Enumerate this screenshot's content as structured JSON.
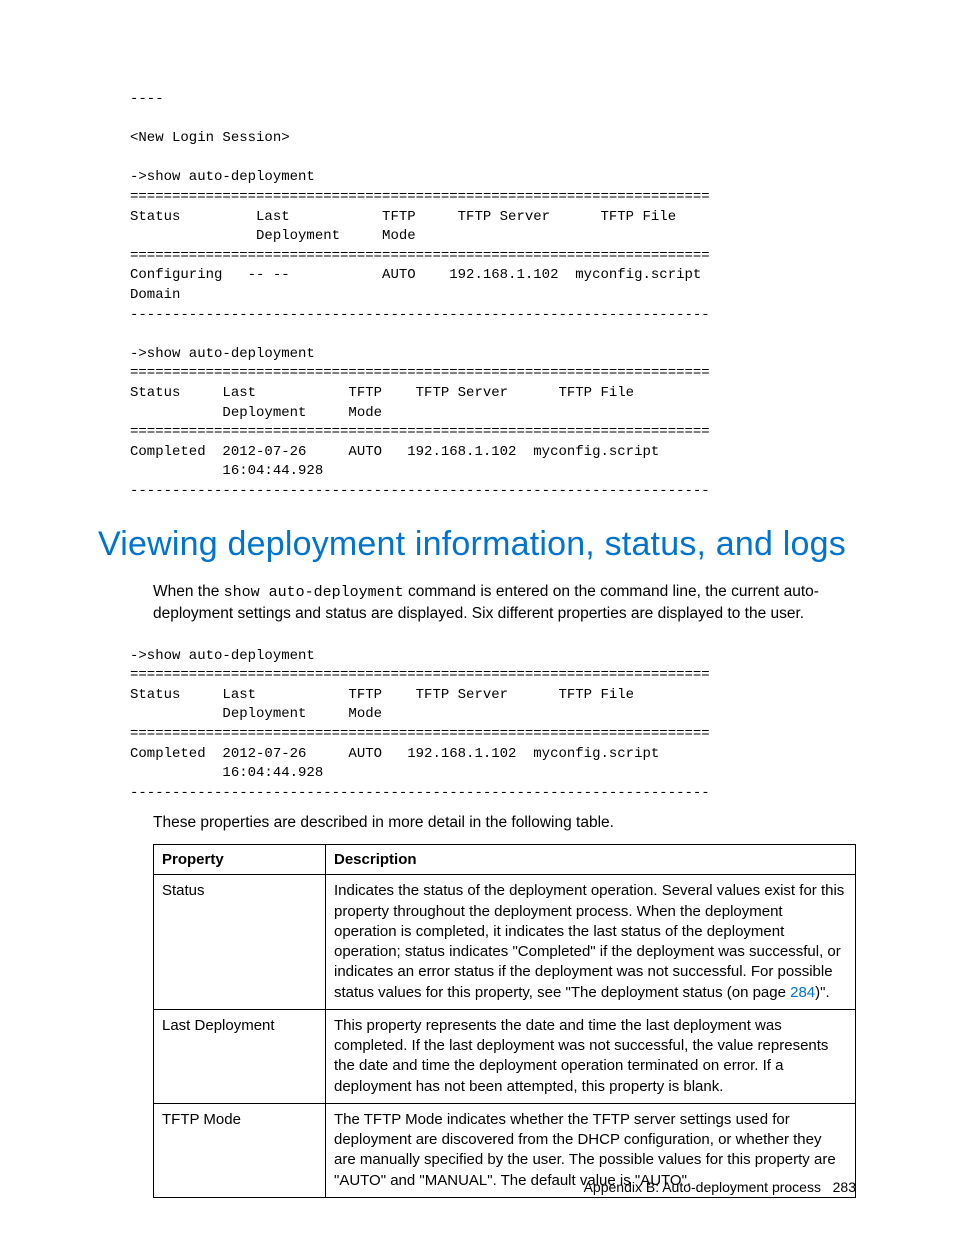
{
  "cli_block_1": "----\n\n<New Login Session>\n\n->show auto-deployment\n=====================================================================\nStatus         Last           TFTP     TFTP Server      TFTP File\n               Deployment     Mode\n=====================================================================\nConfiguring   -- --           AUTO    192.168.1.102  myconfig.script\nDomain\n---------------------------------------------------------------------\n\n->show auto-deployment\n=====================================================================\nStatus     Last           TFTP    TFTP Server      TFTP File\n           Deployment     Mode\n=====================================================================\nCompleted  2012-07-26     AUTO   192.168.1.102  myconfig.script\n           16:04:44.928\n---------------------------------------------------------------------",
  "section_heading": "Viewing deployment information, status, and logs",
  "intro_prefix": "When the ",
  "intro_code": "show auto-deployment",
  "intro_suffix": " command is entered on the command line, the current auto-deployment settings and status are displayed. Six different properties are displayed to the user.",
  "cli_block_2": "->show auto-deployment\n=====================================================================\nStatus     Last           TFTP    TFTP Server      TFTP File\n           Deployment     Mode\n=====================================================================\nCompleted  2012-07-26     AUTO   192.168.1.102  myconfig.script\n           16:04:44.928\n---------------------------------------------------------------------",
  "lead_out": "These properties are described in more detail in the following table.",
  "table": {
    "headers": {
      "c1": "Property",
      "c2": "Description"
    },
    "rows": [
      {
        "name": "Status",
        "desc_prefix": "Indicates the status of the deployment operation.   Several values exist for this property throughout the deployment process. When the deployment operation is completed, it indicates the last status of the deployment operation; status indicates \"Completed\" if the deployment was successful, or indicates an error status if the deployment was not successful. For possible status values for this property, see \"The deployment status (on page ",
        "link": "284",
        "desc_suffix": ")\"."
      },
      {
        "name": "Last Deployment",
        "desc": "This property represents the date and time the last deployment was completed. If the last deployment was not successful, the value represents the date and time the deployment operation terminated on error.  If a deployment has not been attempted, this property is blank."
      },
      {
        "name": "TFTP Mode",
        "desc": "The TFTP Mode indicates whether the TFTP server settings used for deployment are discovered from the DHCP configuration, or whether they are manually specified by the user. The possible values for this property are \"AUTO\" and \"MANUAL\". The default value is \"AUTO\"."
      }
    ]
  },
  "footer": {
    "text": "Appendix B: Auto-deployment process",
    "page": "283"
  }
}
